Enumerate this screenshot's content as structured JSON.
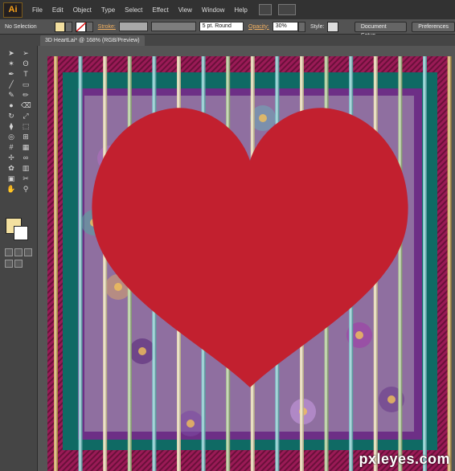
{
  "app": {
    "logo": "Ai"
  },
  "menu": {
    "items": [
      "File",
      "Edit",
      "Object",
      "Type",
      "Select",
      "Effect",
      "View",
      "Window",
      "Help"
    ]
  },
  "control_bar": {
    "selection": "No Selection",
    "stroke_label": "Stroke:",
    "brush": "5 pt. Round",
    "opacity_label": "Opacity:",
    "opacity_value": "30%",
    "style_label": "Style:",
    "document_setup": "Document Setup",
    "preferences": "Preferences"
  },
  "document": {
    "tab_title": "3D HeartLai* @ 168% (RGB/Preview)"
  },
  "tools": [
    "selection-icon",
    "direct-selection-icon",
    "magic-wand-icon",
    "lasso-icon",
    "pen-icon",
    "type-icon",
    "line-icon",
    "rectangle-icon",
    "paintbrush-icon",
    "pencil-icon",
    "blob-brush-icon",
    "eraser-icon",
    "rotate-icon",
    "scale-icon",
    "width-icon",
    "free-transform-icon",
    "shape-builder-icon",
    "perspective-icon",
    "mesh-icon",
    "gradient-icon",
    "eyedropper-icon",
    "blend-icon",
    "symbol-sprayer-icon",
    "graph-icon",
    "artboard-icon",
    "slice-icon",
    "hand-icon",
    "zoom-icon"
  ],
  "colors": {
    "heart": "#c2202f",
    "stripe_pink": "#9a1a56",
    "frame_teal": "#0f6a64",
    "frame_purple": "#6d2f86",
    "pattern_bg": "#8f6fa0",
    "bar_gold": "#cfa13a",
    "bar_cream": "#e8d8a0",
    "bar_teal": "#5fc3c4",
    "bar_green": "#9fc77a"
  },
  "watermark": "pxleyes.com"
}
